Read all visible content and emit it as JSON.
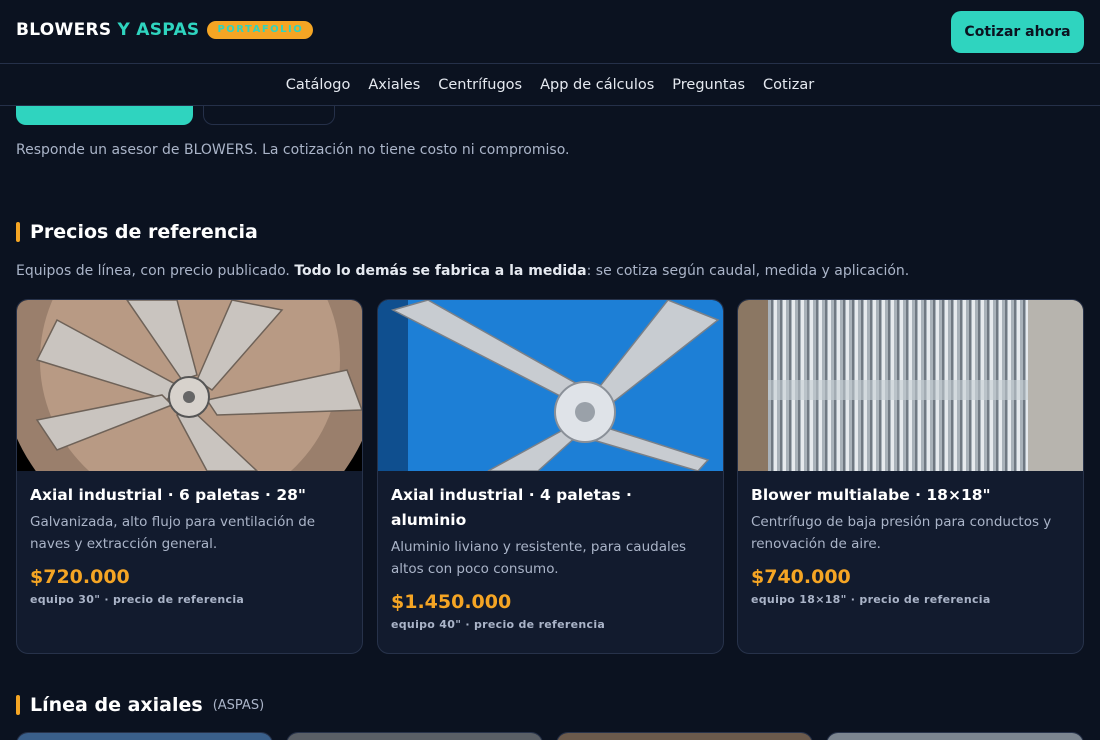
{
  "header": {
    "brand_word1": "BLOWERS",
    "brand_word2": "Y ASPAS",
    "badge": "PORTAFOLIO",
    "cta": "Cotizar ahora"
  },
  "nav": {
    "items": [
      "Catálogo",
      "Axiales",
      "Centrífugos",
      "App de cálculos",
      "Preguntas",
      "Cotizar"
    ]
  },
  "contact_note": "Responde un asesor de BLOWERS. La cotización no tiene costo ni compromiso.",
  "prices_section": {
    "title": "Precios de referencia",
    "intro_pre": "Equipos de línea, con precio publicado. ",
    "intro_bold": "Todo lo demás se fabrica a la medida",
    "intro_post": ": se cotiza según caudal, medida y aplicación.",
    "cards": [
      {
        "name": "Axial industrial · 6 paletas · 28\"",
        "description": "Galvanizada, alto flujo para ventilación de naves y extracción general.",
        "price": "$720.000",
        "meta": "equipo 30\" · precio de referencia"
      },
      {
        "name": "Axial industrial · 4 paletas · aluminio",
        "description": "Aluminio liviano y resistente, para caudales altos con poco consumo.",
        "price": "$1.450.000",
        "meta": "equipo 40\" · precio de referencia"
      },
      {
        "name": "Blower multialabe · 18×18\"",
        "description": "Centrífugo de baja presión para conductos y renovación de aire.",
        "price": "$740.000",
        "meta": "equipo 18×18\" · precio de referencia"
      }
    ]
  },
  "axial_section": {
    "title": "Línea de axiales",
    "subtitle": "(ASPAS)"
  },
  "colors": {
    "background": "#0b1220",
    "accent_teal": "#2fd4bf",
    "accent_orange": "#f5a524",
    "card": "#121b2e"
  }
}
